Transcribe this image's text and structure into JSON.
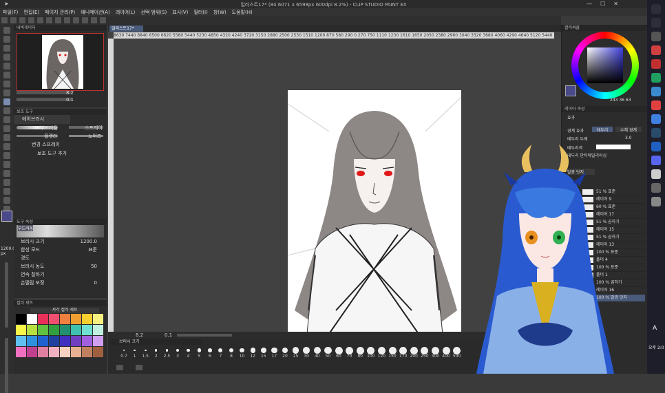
{
  "window": {
    "title": "일러스트17* (84.6071 x 6598px 600dpi 8.2%) - CLIP STUDIO PAINT EX"
  },
  "menu": [
    "파일(F)",
    "편집(E)",
    "페이지 관리(P)",
    "애니메이션(A)",
    "레이어(L)",
    "선택 범위(S)",
    "표시(V)",
    "필터(I)",
    "창(W)",
    "도움말(H)"
  ],
  "canvas_tab": "일러스트17*",
  "ruler_labels": "8630 7440 6840 6500 6620 5580 5440 5230 4850 4320 4240 3720 3150 2880 2500 2530 1510 1200 870 580 290 0 270 750 1110 1230 1610 1650 2050 2380 2960 3040 3320 3680 4060 4290 4640 5120 5440",
  "navigator": {
    "header": "내비게이터",
    "zoom": "8.2",
    "angle": "0.1"
  },
  "subtool": {
    "header": "보조 도구",
    "group": "에어브러시",
    "items": [
      "부드러움",
      "스프레이",
      "플랫라",
      "노이즈",
      "변경 스프레이"
    ],
    "add_label": "보조 도구 추가"
  },
  "tool_property": {
    "header": "도구 속성",
    "brush_name": "부드러움",
    "rows": [
      {
        "label": "브러시 크기",
        "value": "1200.0"
      },
      {
        "label": "합성 모드",
        "value": "표준"
      },
      {
        "label": "경도",
        "value": ""
      },
      {
        "label": "브러시 농도",
        "value": "50"
      },
      {
        "label": "연속 칠하기",
        "value": ""
      },
      {
        "label": "손떨림 보정",
        "value": "0"
      }
    ]
  },
  "color_set": {
    "header": "컬러 세트",
    "name": "서각 컬러 세트",
    "swatches": [
      "#000000",
      "#ffffff",
      "#e8305a",
      "#f05070",
      "#f08040",
      "#f0a030",
      "#f8d030",
      "#f8f080",
      "#f8f848",
      "#b8e040",
      "#60c040",
      "#30a040",
      "#209070",
      "#40c0b0",
      "#70e0d0",
      "#c0f0e0",
      "#60c0f0",
      "#3090e0",
      "#2060d0",
      "#2040a0",
      "#4030c0",
      "#7040c0",
      "#a060e0",
      "#d0a0f0",
      "#f070c0",
      "#c04090",
      "#e080a0",
      "#f0b0c0",
      "#f8d0c0",
      "#e8b090",
      "#c08060",
      "#a06040"
    ]
  },
  "color_wheel": {
    "header": "컬러써클",
    "hsv": "243 36 63"
  },
  "layer_props": {
    "header": "레이어 속성",
    "effect_label": "효과",
    "boundary_label": "경계 효과",
    "boundary_value": "테두리",
    "water_label": "수채 경계",
    "thickness_label": "테두리 두께",
    "thickness_value": "3.0",
    "color_label": "테두리색",
    "antialias_label": "테두리 안티에일리어싱"
  },
  "layers": {
    "blend": "발광 닷지",
    "rows": [
      {
        "label": "51 % 표준",
        "sel": false
      },
      {
        "label": "레이어 9",
        "sel": false
      },
      {
        "label": "60 % 표준",
        "sel": false
      },
      {
        "label": "레이어 17",
        "sel": false
      },
      {
        "label": "51 % 곱하기",
        "sel": false
      },
      {
        "label": "레이어 15",
        "sel": false
      },
      {
        "label": "51 % 곱하기",
        "sel": false
      },
      {
        "label": "레이어 13",
        "sel": false
      },
      {
        "label": "100 % 표준",
        "sel": false
      },
      {
        "label": "폴더 4",
        "sel": false
      },
      {
        "label": "100 % 표준",
        "sel": false
      },
      {
        "label": "폴더 1",
        "sel": false
      },
      {
        "label": "100 % 곱하기",
        "sel": false
      },
      {
        "label": "레이어 16",
        "sel": false
      },
      {
        "label": "100 % 발광 닷지",
        "sel": true
      }
    ]
  },
  "status": {
    "zoom": "8.2",
    "angle": "0.1"
  },
  "brush_size": {
    "header": "브러시 크기",
    "sizes": [
      "0.7",
      "1",
      "1.5",
      "2",
      "2.5",
      "3",
      "4",
      "5",
      "6",
      "7",
      "8",
      "10",
      "12",
      "15",
      "17",
      "20",
      "25",
      "30",
      "40",
      "50",
      "60",
      "70",
      "80",
      "100",
      "120",
      "150",
      "170",
      "200",
      "250",
      "300",
      "400",
      "500"
    ]
  },
  "left_size": {
    "value": "1200.0",
    "unit": "px"
  },
  "taskbar": {
    "lang": "A",
    "clock": "오후 2:0"
  }
}
